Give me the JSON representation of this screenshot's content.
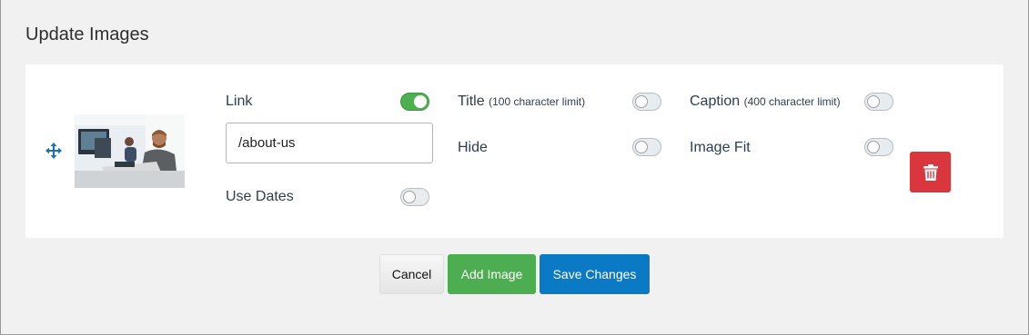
{
  "section": {
    "title": "Update Images"
  },
  "image_item": {
    "link": {
      "label": "Link",
      "value": "/about-us",
      "enabled": true
    },
    "use_dates": {
      "label": "Use Dates",
      "enabled": false
    },
    "title": {
      "label": "Title",
      "hint": "(100 character limit)",
      "enabled": false
    },
    "hide": {
      "label": "Hide",
      "enabled": false
    },
    "caption": {
      "label": "Caption",
      "hint": "(400 character limit)",
      "enabled": false
    },
    "image_fit": {
      "label": "Image Fit",
      "enabled": false
    },
    "icons": {
      "drag": "move-arrows-icon",
      "delete": "trash-icon"
    }
  },
  "actions": {
    "cancel": "Cancel",
    "add_image": "Add Image",
    "save_changes": "Save Changes"
  },
  "colors": {
    "toggle_on": "#4caf50",
    "delete": "#d9363e",
    "add": "#4cae50",
    "save": "#0a7ac4"
  }
}
